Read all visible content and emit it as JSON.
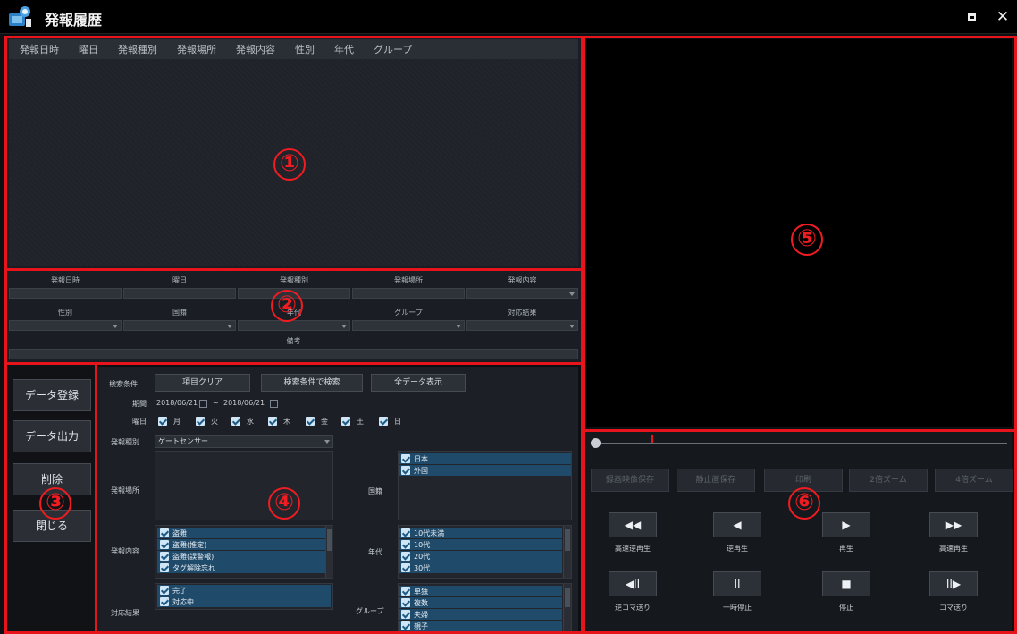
{
  "window": {
    "title": "発報履歴",
    "maximize_icon": "maximize-icon",
    "close_glyph": "✕"
  },
  "list": {
    "columns": [
      "発報日時",
      "曜日",
      "発報種別",
      "発報場所",
      "発報内容",
      "性別",
      "年代",
      "グループ"
    ]
  },
  "detail": {
    "row1": [
      "発報日時",
      "曜日",
      "発報種別",
      "発報場所",
      "発報内容"
    ],
    "row2": [
      "性別",
      "国籍",
      "年代",
      "グループ",
      "対応結果"
    ],
    "notes_label": "備考"
  },
  "side": {
    "register": "データ登録",
    "export": "データ出力",
    "delete": "削除",
    "close": "閉じる"
  },
  "search": {
    "criteria_label": "検索条件",
    "clear_btn": "項目クリア",
    "search_btn": "検索条件で検索",
    "all_btn": "全データ表示",
    "period_label": "期間",
    "date_from": "2018/06/21",
    "date_sep": "~",
    "date_to": "2018/06/21",
    "weekday_label": "曜日",
    "weekdays": [
      "月",
      "火",
      "水",
      "木",
      "金",
      "土",
      "日"
    ],
    "type_label": "発報種別",
    "type_value": "ゲートセンサー",
    "place_label": "発報場所",
    "content_label": "発報内容",
    "content_items": [
      "盗難",
      "盗難(推定)",
      "盗難(誤警報)",
      "タグ解除忘れ"
    ],
    "result_label": "対応結果",
    "result_items": [
      "完了",
      "対応中"
    ],
    "nationality_label": "国籍",
    "nationality_items": [
      "日本",
      "外国"
    ],
    "age_label": "年代",
    "age_items": [
      "10代未満",
      "10代",
      "20代",
      "30代"
    ],
    "group_label": "グループ",
    "group_items": [
      "単独",
      "複数",
      "夫婦",
      "親子"
    ]
  },
  "player": {
    "zoom_buttons": [
      "録画映像保存",
      "静止画保存",
      "印刷",
      "2倍ズーム",
      "4倍ズーム"
    ],
    "row1": [
      {
        "glyph": "◀◀",
        "label": "高速逆再生",
        "icon": "fast-rewind-icon"
      },
      {
        "glyph": "◀",
        "label": "逆再生",
        "icon": "reverse-play-icon"
      },
      {
        "glyph": "▶",
        "label": "再生",
        "icon": "play-icon"
      },
      {
        "glyph": "▶▶",
        "label": "高速再生",
        "icon": "fast-forward-icon"
      }
    ],
    "row2": [
      {
        "glyph": "◀II",
        "label": "逆コマ送り",
        "icon": "step-back-icon"
      },
      {
        "glyph": "II",
        "label": "一時停止",
        "icon": "pause-icon"
      },
      {
        "glyph": "■",
        "label": "停止",
        "icon": "stop-icon"
      },
      {
        "glyph": "II▶",
        "label": "コマ送り",
        "icon": "step-forward-icon"
      }
    ]
  },
  "annotations": [
    "①",
    "②",
    "③",
    "④",
    "⑤",
    "⑥"
  ],
  "colors": {
    "highlight_red": "#e8141c",
    "selection_blue": "#1f4a6a",
    "background": "#1a1e24"
  }
}
